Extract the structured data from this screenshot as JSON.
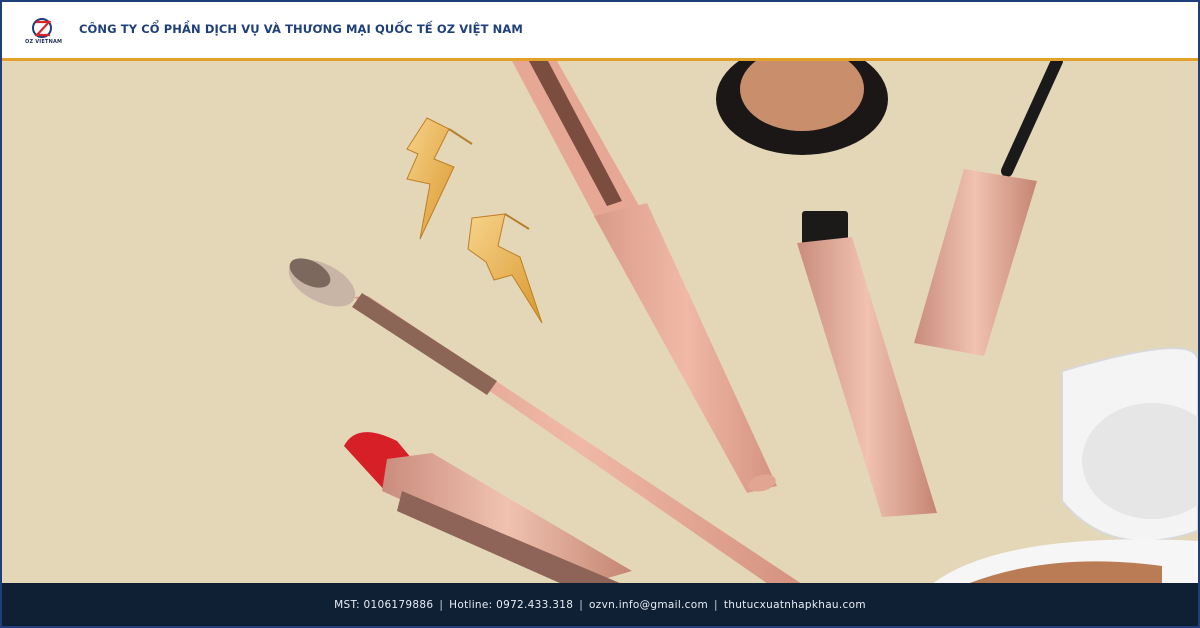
{
  "header": {
    "logo_text": "OZ VIETNAM",
    "company_name": "CÔNG TY CỔ PHẦN DỊCH VỤ VÀ THƯƠNG MẠI QUỐC TẾ OZ VIỆT NAM"
  },
  "hero": {
    "items": [
      "lightning-earring-icon",
      "lightning-earring-icon",
      "makeup-brush-icon",
      "concealer-pen-icon",
      "compact-powder-icon",
      "mascara-icon",
      "lipstick-icon",
      "cushion-compact-icon"
    ]
  },
  "footer": {
    "mst": "MST: 0106179886",
    "hotline": "Hotline: 0972.433.318",
    "email": "ozvn.info@gmail.com",
    "website": "thutucxuatnhapkhau.com",
    "separator": "|"
  },
  "colors": {
    "header_border": "#e3a02b",
    "brand_navy": "#1f3f7a",
    "footer_bg": "#0f2035",
    "hero_bg": "#e4d7b8"
  }
}
